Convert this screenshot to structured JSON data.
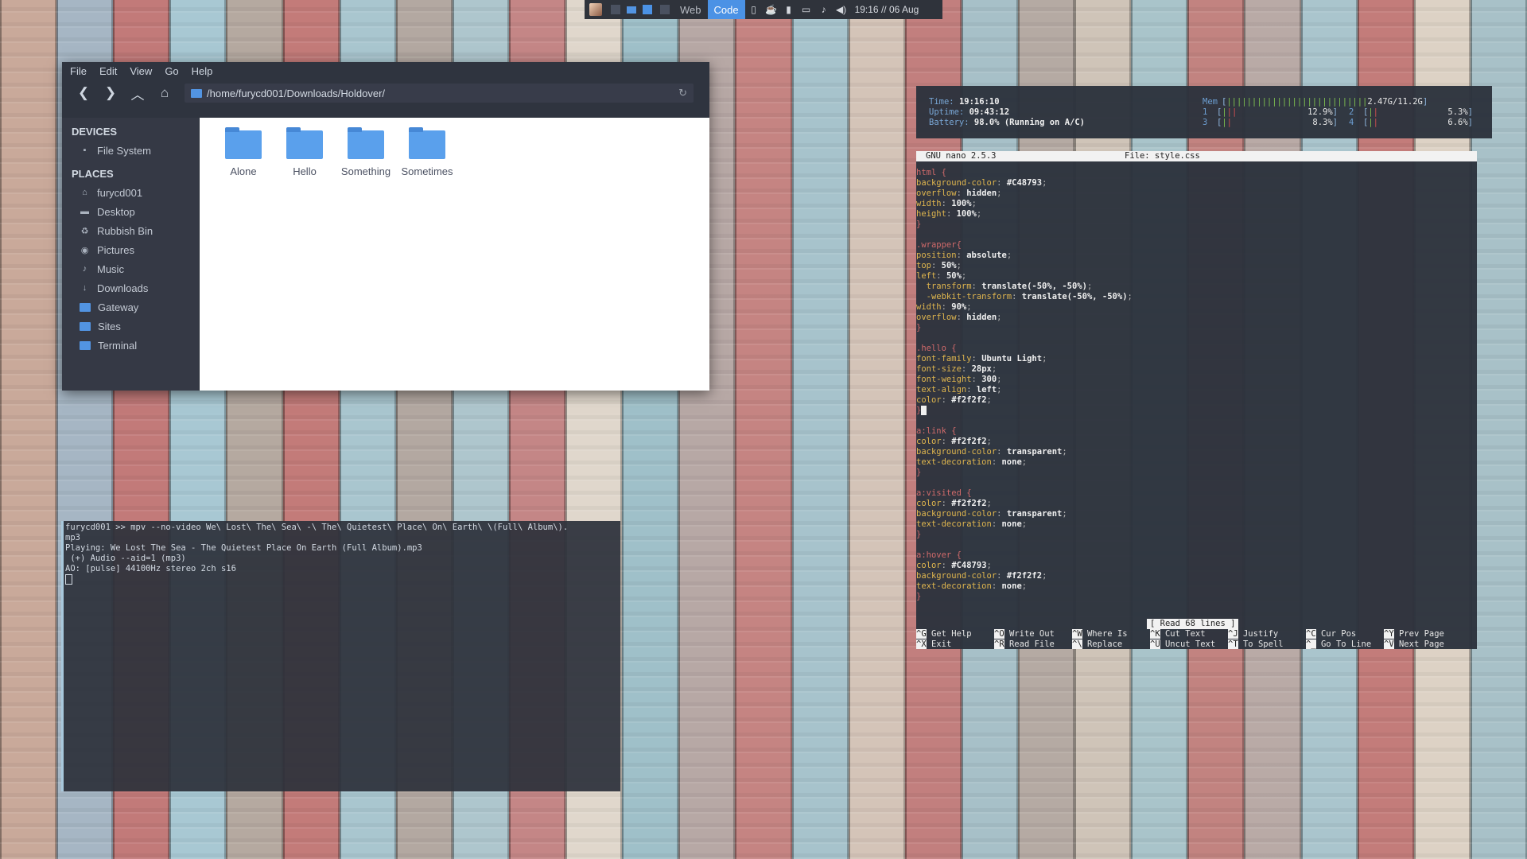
{
  "wallpaper": {
    "planks": [
      "#c9a99a",
      "#a6b6c4",
      "#c27a79",
      "#a8c8d3",
      "#b5a9a0",
      "#c37b79",
      "#a9c6cf",
      "#b3a8a1",
      "#aec6cd",
      "#c48686",
      "#e0d7cc",
      "#9fc0c9",
      "#b7a8a5",
      "#c58482",
      "#a7c3cc",
      "#d4c4b8",
      "#c27f7e",
      "#a7c0c8",
      "#b5aaa3",
      "#cfc4b8",
      "#a9c4ca",
      "#c28380",
      "#b9aaa6",
      "#aac5cd",
      "#c37c7a",
      "#ddd2c5",
      "#a8c1c8"
    ]
  },
  "top_panel": {
    "workspaces": [
      "Web",
      "Code"
    ],
    "active_workspace": "Code",
    "tray_icons": [
      "clipboard-icon",
      "coffee-icon",
      "battery-icon",
      "display-icon",
      "bell-icon",
      "volume-icon"
    ],
    "clock": "19:16 // 06 Aug"
  },
  "file_manager": {
    "menu": [
      "File",
      "Edit",
      "View",
      "Go",
      "Help"
    ],
    "path": "/home/furycd001/Downloads/Holdover/",
    "devices_header": "DEVICES",
    "devices": [
      {
        "label": "File System",
        "icon": "drive-icon"
      }
    ],
    "places_header": "PLACES",
    "places": [
      {
        "label": "furycd001",
        "icon": "home-icon"
      },
      {
        "label": "Desktop",
        "icon": "desktop-icon"
      },
      {
        "label": "Rubbish Bin",
        "icon": "trash-icon"
      },
      {
        "label": "Pictures",
        "icon": "camera-icon"
      },
      {
        "label": "Music",
        "icon": "music-icon"
      },
      {
        "label": "Downloads",
        "icon": "download-icon"
      },
      {
        "label": "Gateway",
        "icon": "folder-icon"
      },
      {
        "label": "Sites",
        "icon": "folder-icon"
      },
      {
        "label": "Terminal",
        "icon": "folder-icon"
      }
    ],
    "files": [
      "Alone",
      "Hello",
      "Something",
      "Sometimes"
    ]
  },
  "terminal": {
    "lines": [
      "furycd001 >> mpv --no-video We\\ Lost\\ The\\ Sea\\ -\\ The\\ Quietest\\ Place\\ On\\ Earth\\ \\(Full\\ Album\\).",
      "mp3",
      "Playing: We Lost The Sea - The Quietest Place On Earth (Full Album).mp3",
      " (+) Audio --aid=1 (mp3)",
      "AO: [pulse] 44100Hz stereo 2ch s16"
    ]
  },
  "htop": {
    "time_label": "Time:",
    "time": "19:16:10",
    "uptime_label": "Uptime:",
    "uptime": "09:43:12",
    "battery_label": "Battery:",
    "battery": "98.0% (Running on A/C)",
    "mem_label": "Mem",
    "mem_value": "2.47G/11.2G",
    "mem_fraction": 0.22,
    "cpus": [
      {
        "id": "1",
        "pct": "12.9%",
        "fraction": 0.129
      },
      {
        "id": "2",
        "pct": "5.3%",
        "fraction": 0.053
      },
      {
        "id": "3",
        "pct": "8.3%",
        "fraction": 0.083
      },
      {
        "id": "4",
        "pct": "6.6%",
        "fraction": 0.066
      }
    ]
  },
  "nano": {
    "version": "GNU nano 2.5.3",
    "file": "File: style.css",
    "status": "[ Read 68 lines ]",
    "code": [
      [
        "sel",
        "html {"
      ],
      [
        "kv",
        "background-color",
        "#C48793"
      ],
      [
        "kv",
        "overflow",
        "hidden"
      ],
      [
        "kv",
        "width",
        "100%"
      ],
      [
        "kv",
        "height",
        "100%"
      ],
      [
        "close",
        "}"
      ],
      [
        "blank",
        ""
      ],
      [
        "sel",
        ".wrapper{"
      ],
      [
        "kv",
        "position",
        "absolute"
      ],
      [
        "kv",
        "top",
        "50%"
      ],
      [
        "kv",
        "left",
        "50%"
      ],
      [
        "kv",
        "  transform",
        "translate(-50%, -50%)"
      ],
      [
        "kv",
        "  -webkit-transform",
        "translate(-50%, -50%)"
      ],
      [
        "kv",
        "width",
        "90%"
      ],
      [
        "kv",
        "overflow",
        "hidden"
      ],
      [
        "close",
        "}"
      ],
      [
        "blank",
        ""
      ],
      [
        "sel",
        ".hello {"
      ],
      [
        "kv",
        "font-family",
        "Ubuntu Light"
      ],
      [
        "kv",
        "font-size",
        "28px"
      ],
      [
        "kv",
        "font-weight",
        "300"
      ],
      [
        "kv",
        "text-align",
        "left"
      ],
      [
        "kv",
        "color",
        "#f2f2f2"
      ],
      [
        "cursor",
        "}"
      ],
      [
        "blank",
        ""
      ],
      [
        "sel",
        "a:link {"
      ],
      [
        "kv",
        "color",
        "#f2f2f2"
      ],
      [
        "kv",
        "background-color",
        "transparent"
      ],
      [
        "kv",
        "text-decoration",
        "none"
      ],
      [
        "close",
        "}"
      ],
      [
        "blank",
        ""
      ],
      [
        "sel",
        "a:visited {"
      ],
      [
        "kv",
        "color",
        "#f2f2f2"
      ],
      [
        "kv",
        "background-color",
        "transparent"
      ],
      [
        "kv",
        "text-decoration",
        "none"
      ],
      [
        "close",
        "}"
      ],
      [
        "blank",
        ""
      ],
      [
        "sel",
        "a:hover {"
      ],
      [
        "kv",
        "color",
        "#C48793"
      ],
      [
        "kv",
        "background-color",
        "#f2f2f2"
      ],
      [
        "kv",
        "text-decoration",
        "none"
      ],
      [
        "close",
        "}"
      ]
    ],
    "help": [
      [
        [
          "^G",
          "Get Help"
        ],
        [
          "^O",
          "Write Out"
        ],
        [
          "^W",
          "Where Is"
        ],
        [
          "^K",
          "Cut Text"
        ],
        [
          "^J",
          "Justify"
        ],
        [
          "^C",
          "Cur Pos"
        ],
        [
          "^Y",
          "Prev Page"
        ]
      ],
      [
        [
          "^X",
          "Exit"
        ],
        [
          "^R",
          "Read File"
        ],
        [
          "^\\",
          "Replace"
        ],
        [
          "^U",
          "Uncut Text"
        ],
        [
          "^T",
          "To Spell"
        ],
        [
          "^_",
          "Go To Line"
        ],
        [
          "^V",
          "Next Page"
        ]
      ]
    ]
  }
}
